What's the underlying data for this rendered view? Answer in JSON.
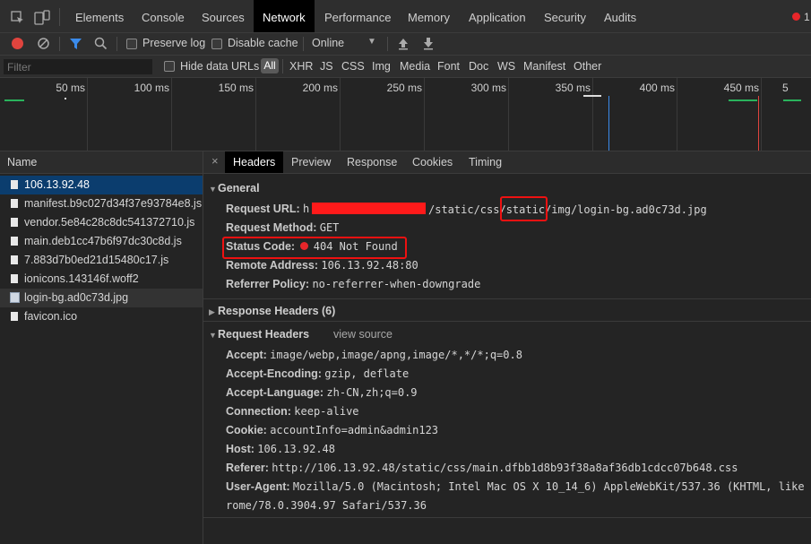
{
  "tabs": [
    "Elements",
    "Console",
    "Sources",
    "Network",
    "Performance",
    "Memory",
    "Application",
    "Security",
    "Audits"
  ],
  "error_count": "1",
  "toolbar": {
    "preserve_log": "Preserve log",
    "disable_cache": "Disable cache",
    "throttle": "Online"
  },
  "filter": {
    "placeholder": "Filter",
    "hide_data_urls": "Hide data URLs",
    "all": "All",
    "types": [
      "XHR",
      "JS",
      "CSS",
      "Img",
      "Media",
      "Font",
      "Doc",
      "WS",
      "Manifest",
      "Other"
    ]
  },
  "timeline": {
    "ticks": [
      "50 ms",
      "100 ms",
      "150 ms",
      "200 ms",
      "250 ms",
      "300 ms",
      "350 ms",
      "400 ms",
      "450 ms",
      "5"
    ]
  },
  "requests": {
    "header": "Name",
    "items": [
      "106.13.92.48",
      "manifest.b9c027d34f37e93784e8.js",
      "vendor.5e84c28c8dc541372710.js",
      "main.deb1cc47b6f97dc30c8d.js",
      "7.883d7b0ed21d15480c17.js",
      "ionicons.143146f.woff2",
      "login-bg.ad0c73d.jpg",
      "favicon.ico"
    ]
  },
  "detail_tabs": [
    "Headers",
    "Preview",
    "Response",
    "Cookies",
    "Timing"
  ],
  "general": {
    "title": "General",
    "request_url_key": "Request URL:",
    "request_url_prefix": "h",
    "request_url_mid": "/static/css/",
    "request_url_highlight": "static",
    "request_url_suffix": "/img/login-bg.ad0c73d.jpg",
    "request_method_key": "Request Method:",
    "request_method": "GET",
    "status_code_key": "Status Code:",
    "status_code": "404 Not Found",
    "remote_address_key": "Remote Address:",
    "remote_address": "106.13.92.48:80",
    "referrer_policy_key": "Referrer Policy:",
    "referrer_policy": "no-referrer-when-downgrade"
  },
  "response_headers": {
    "title": "Response Headers (6)"
  },
  "request_headers": {
    "title": "Request Headers",
    "view_source": "view source",
    "items": [
      {
        "key": "Accept:",
        "value": "image/webp,image/apng,image/*,*/*;q=0.8"
      },
      {
        "key": "Accept-Encoding:",
        "value": "gzip, deflate"
      },
      {
        "key": "Accept-Language:",
        "value": "zh-CN,zh;q=0.9"
      },
      {
        "key": "Connection:",
        "value": "keep-alive"
      },
      {
        "key": "Cookie:",
        "value": "accountInfo=admin&admin123"
      },
      {
        "key": "Host:",
        "value": "106.13.92.48"
      },
      {
        "key": "Referer:",
        "value": "http://106.13.92.48/static/css/main.dfbb1d8b93f38a8af36db1cdcc07b648.css"
      },
      {
        "key": "User-Agent:",
        "value": "Mozilla/5.0 (Macintosh; Intel Mac OS X 10_14_6) AppleWebKit/537.36 (KHTML, like"
      }
    ],
    "user_agent_cont": "rome/78.0.3904.97 Safari/537.36"
  },
  "colors": {
    "accent": "#0b3d6e",
    "annotation": "#ee1111",
    "record": "#e0443e",
    "status_error": "#e8262a"
  }
}
